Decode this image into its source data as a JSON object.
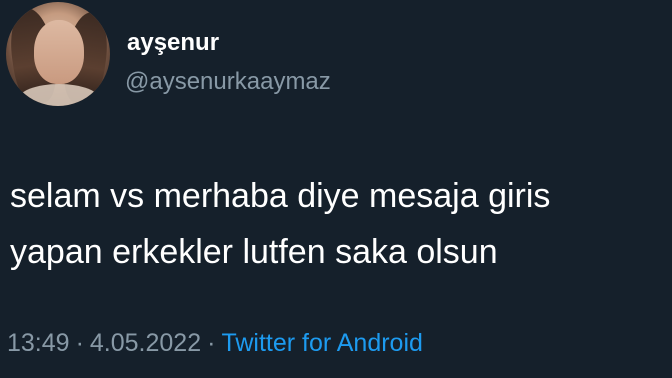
{
  "profile": {
    "display_name": "ayşenur",
    "handle": "@aysenurkaaymaz"
  },
  "tweet": {
    "text_lines": [
      "selam vs merhaba diye mesaja giris",
      "yapan erkekler lutfen saka olsun"
    ]
  },
  "meta": {
    "time": "13:49",
    "separator": "·",
    "date": "4.05.2022",
    "source": "Twitter for Android"
  },
  "colors": {
    "background": "#15202b",
    "text": "#ffffff",
    "muted": "#8899a6",
    "link": "#1d9bf0"
  },
  "icons": {
    "avatar": "profile-photo"
  }
}
